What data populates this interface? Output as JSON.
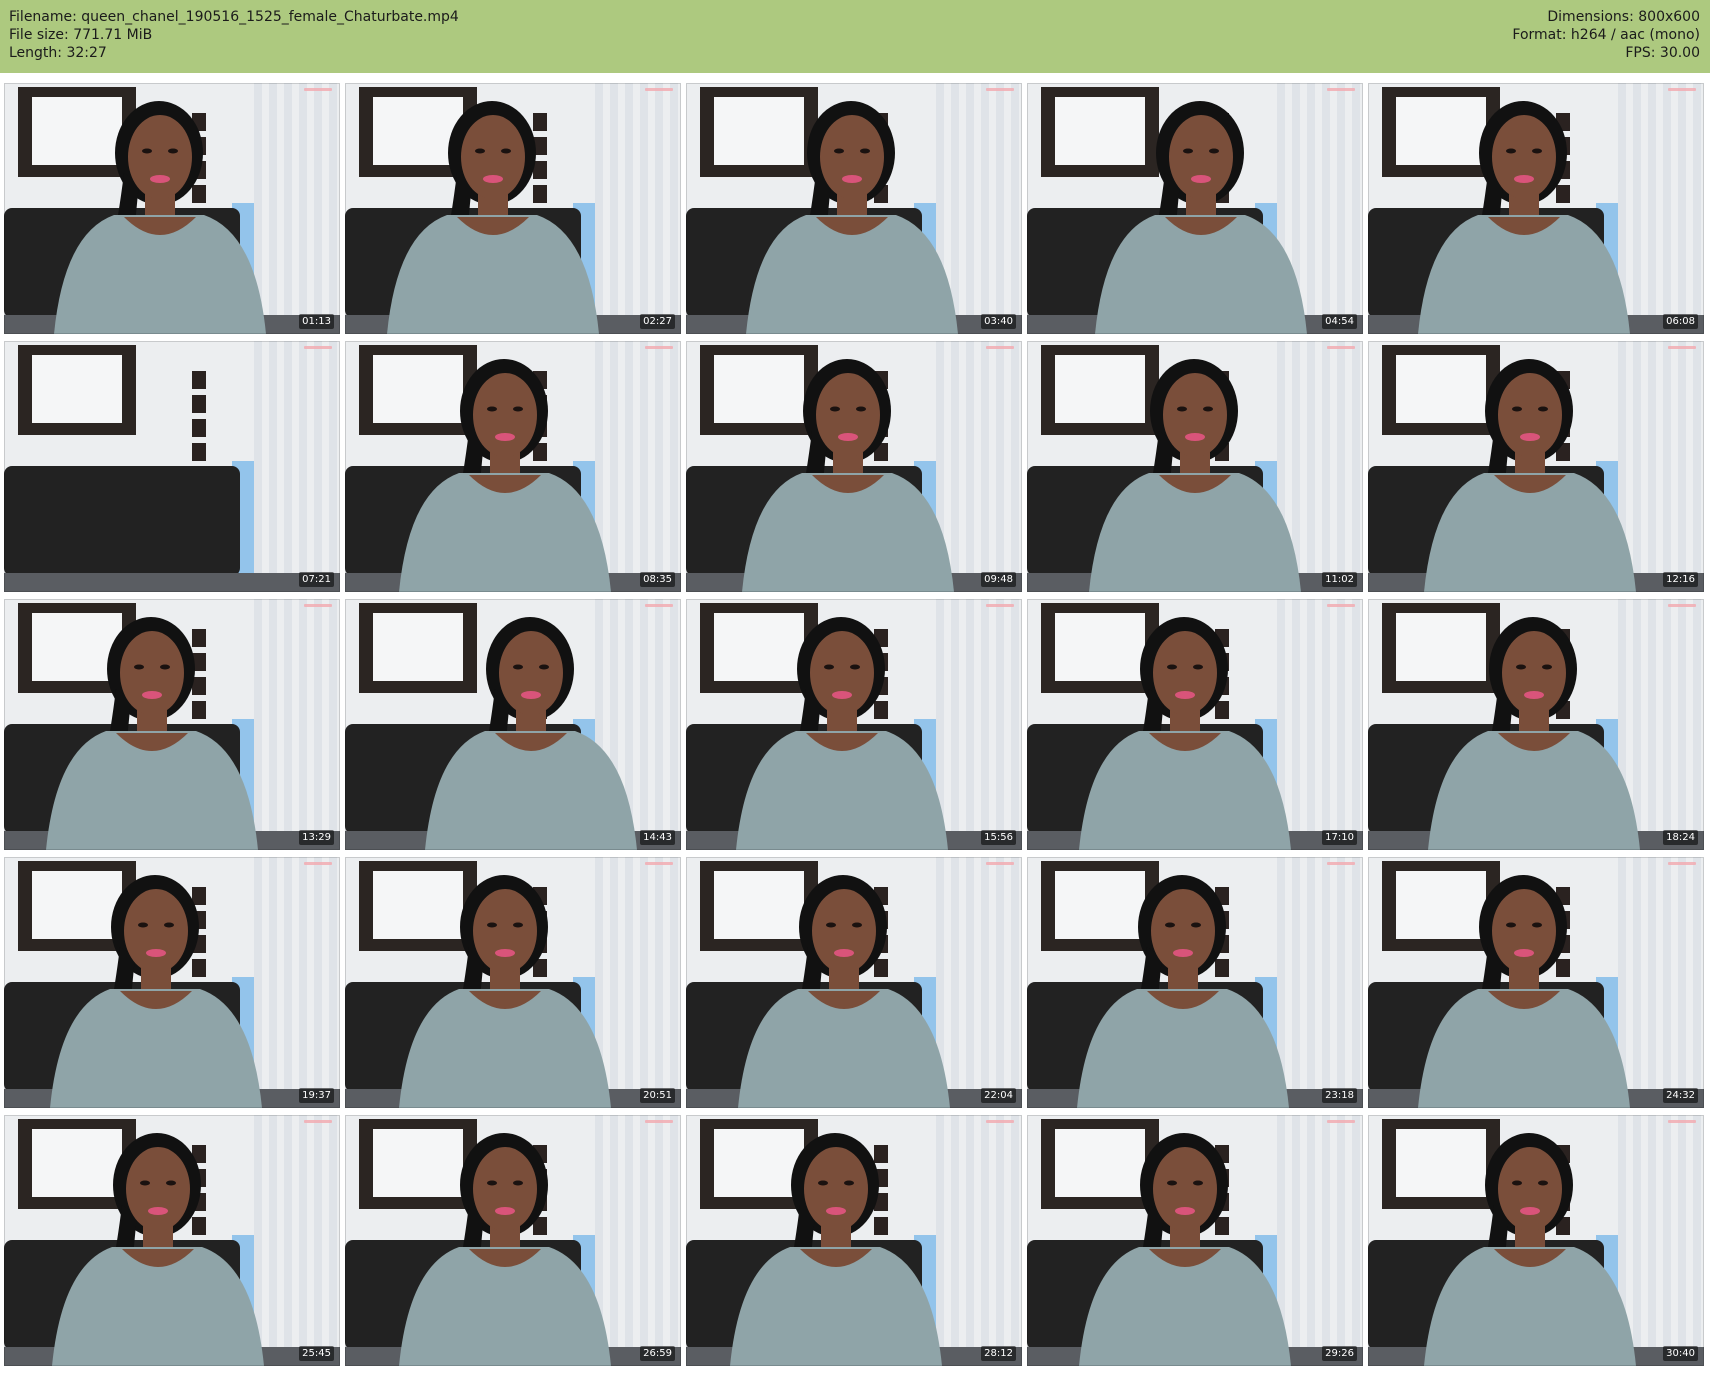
{
  "header": {
    "filename": "Filename: queen_chanel_190516_1525_female_Chaturbate.mp4",
    "filesize": "File size: 771.71 MiB",
    "length": "Length: 32:27",
    "dimensions": "Dimensions: 800x600",
    "format": "Format: h264 / aac (mono)",
    "fps": "FPS: 30.00"
  },
  "colors": {
    "header_bg": "#adc97f",
    "wall": "#eceef0",
    "sofa": "#222222",
    "sweater": "#8fa4a8",
    "skin": "#7a4e3a",
    "hair": "#111111",
    "blue_light": "#4aa3e8"
  },
  "thumbnails": [
    {
      "timestamp": "01:13",
      "person": true
    },
    {
      "timestamp": "02:27",
      "person": true
    },
    {
      "timestamp": "03:40",
      "person": true
    },
    {
      "timestamp": "04:54",
      "person": true
    },
    {
      "timestamp": "06:08",
      "person": true
    },
    {
      "timestamp": "07:21",
      "person": false
    },
    {
      "timestamp": "08:35",
      "person": true
    },
    {
      "timestamp": "09:48",
      "person": true
    },
    {
      "timestamp": "11:02",
      "person": true
    },
    {
      "timestamp": "12:16",
      "person": true
    },
    {
      "timestamp": "13:29",
      "person": true
    },
    {
      "timestamp": "14:43",
      "person": true
    },
    {
      "timestamp": "15:56",
      "person": true
    },
    {
      "timestamp": "17:10",
      "person": true
    },
    {
      "timestamp": "18:24",
      "person": true
    },
    {
      "timestamp": "19:37",
      "person": true
    },
    {
      "timestamp": "20:51",
      "person": true
    },
    {
      "timestamp": "22:04",
      "person": true
    },
    {
      "timestamp": "23:18",
      "person": true
    },
    {
      "timestamp": "24:32",
      "person": true
    },
    {
      "timestamp": "25:45",
      "person": true
    },
    {
      "timestamp": "26:59",
      "person": true
    },
    {
      "timestamp": "28:12",
      "person": true
    },
    {
      "timestamp": "29:26",
      "person": true
    },
    {
      "timestamp": "30:40",
      "person": true
    }
  ]
}
